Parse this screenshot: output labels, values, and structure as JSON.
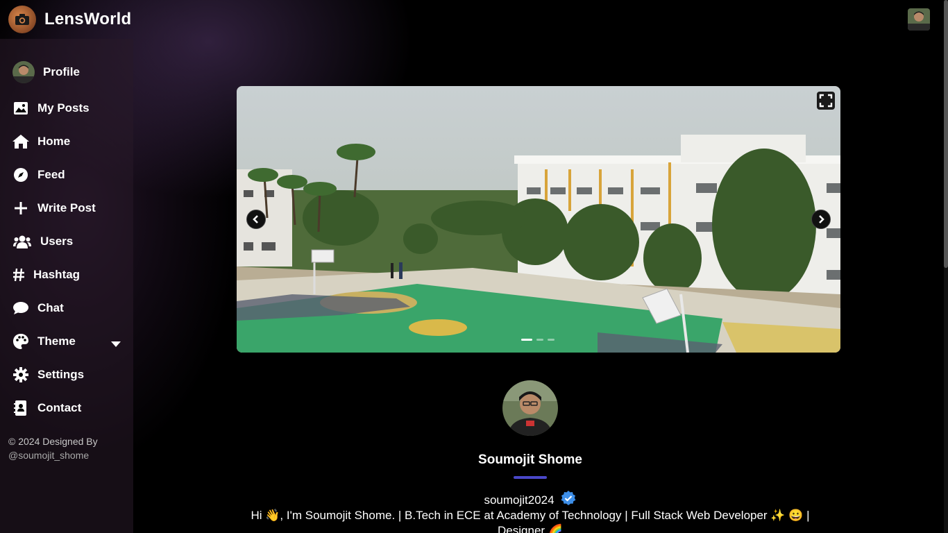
{
  "app": {
    "name": "LensWorld",
    "logo_icon": "camera-icon"
  },
  "sidebar": {
    "items": [
      {
        "label": "Profile",
        "icon": "avatar"
      },
      {
        "label": "My Posts",
        "icon": "image-icon"
      },
      {
        "label": "Home",
        "icon": "home-icon"
      },
      {
        "label": "Feed",
        "icon": "compass-icon"
      },
      {
        "label": "Write Post",
        "icon": "plus-icon"
      },
      {
        "label": "Users",
        "icon": "users-icon"
      },
      {
        "label": "Hashtag",
        "icon": "hashtag-icon"
      },
      {
        "label": "Chat",
        "icon": "chat-icon"
      },
      {
        "label": "Theme",
        "icon": "palette-icon"
      },
      {
        "label": "Settings",
        "icon": "gear-icon"
      },
      {
        "label": "Contact",
        "icon": "contact-card-icon"
      }
    ],
    "footer_prefix": "© 2024 Designed By",
    "footer_handle": "@soumojit_shome"
  },
  "profile": {
    "name": "Soumojit Shome",
    "username": "soumojit2024",
    "bio": "Hi 👋, I'm Soumojit Shome. | B.Tech in ECE at Academy of Technology | Full Stack Web Developer ✨ 😀 | Designer 🌈"
  },
  "carousel": {
    "slide_count": 3,
    "active_index": 0
  },
  "colors": {
    "accent": "#4a48c9",
    "verified": "#3d8ee8",
    "background": "#000000"
  }
}
